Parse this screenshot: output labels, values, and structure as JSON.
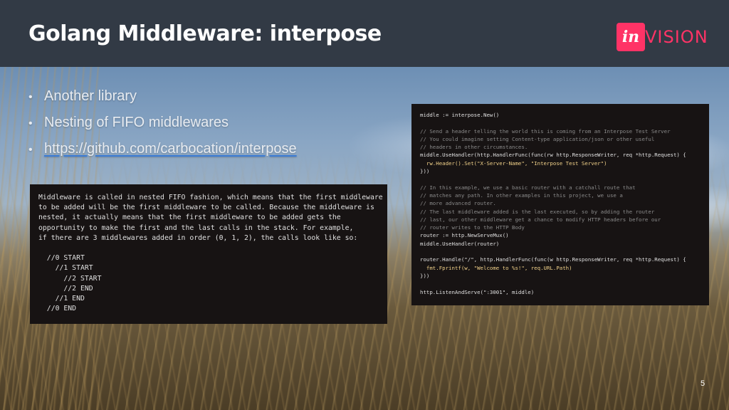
{
  "slide": {
    "title": "Golang Middleware: interpose",
    "logo": {
      "mark": "in",
      "word": "VISION",
      "color": "#ff3366"
    },
    "page_number": "5"
  },
  "bullets": [
    {
      "text": "Another library"
    },
    {
      "text": "Nesting of FIFO middlewares"
    },
    {
      "text": "https://github.com/carbocation/interpose",
      "link": true
    }
  ],
  "left_code": {
    "lines": [
      "Middleware is called in nested FIFO fashion, which means that the first middleware",
      "to be added will be the first middleware to be called. Because the middleware is",
      "nested, it actually means that the first middleware to be added gets the",
      "opportunity to make the first and the last calls in the stack. For example,",
      "if there are 3 middlewares added in order (0, 1, 2), the calls look like so:",
      "",
      "  //0 START",
      "    //1 START",
      "      //2 START",
      "      //2 END",
      "    //1 END",
      "  //0 END"
    ]
  },
  "right_code": {
    "lines": [
      "middle := interpose.New()",
      "",
      "// Send a header telling the world this is coming from an Interpose Test Server",
      "// You could imagine setting Content-type application/json or other useful",
      "// headers in other circumstances.",
      "middle.UseHandler(http.HandlerFunc(func(rw http.ResponseWriter, req *http.Request) {",
      "  rw.Header().Set(\"X-Server-Name\", \"Interpose Test Server\")",
      "}))",
      "",
      "// In this example, we use a basic router with a catchall route that",
      "// matches any path. In other examples in this project, we use a",
      "// more advanced router.",
      "// The last middleware added is the last executed, so by adding the router",
      "// last, our other middleware get a chance to modify HTTP headers before our",
      "// router writes to the HTTP Body",
      "router := http.NewServeMux()",
      "middle.UseHandler(router)",
      "",
      "router.Handle(\"/\", http.HandlerFunc(func(w http.ResponseWriter, req *http.Request) {",
      "  fmt.Fprintf(w, \"Welcome to %s!\", req.URL.Path)",
      "}))",
      "",
      "http.ListenAndServe(\":3001\", middle)"
    ]
  }
}
